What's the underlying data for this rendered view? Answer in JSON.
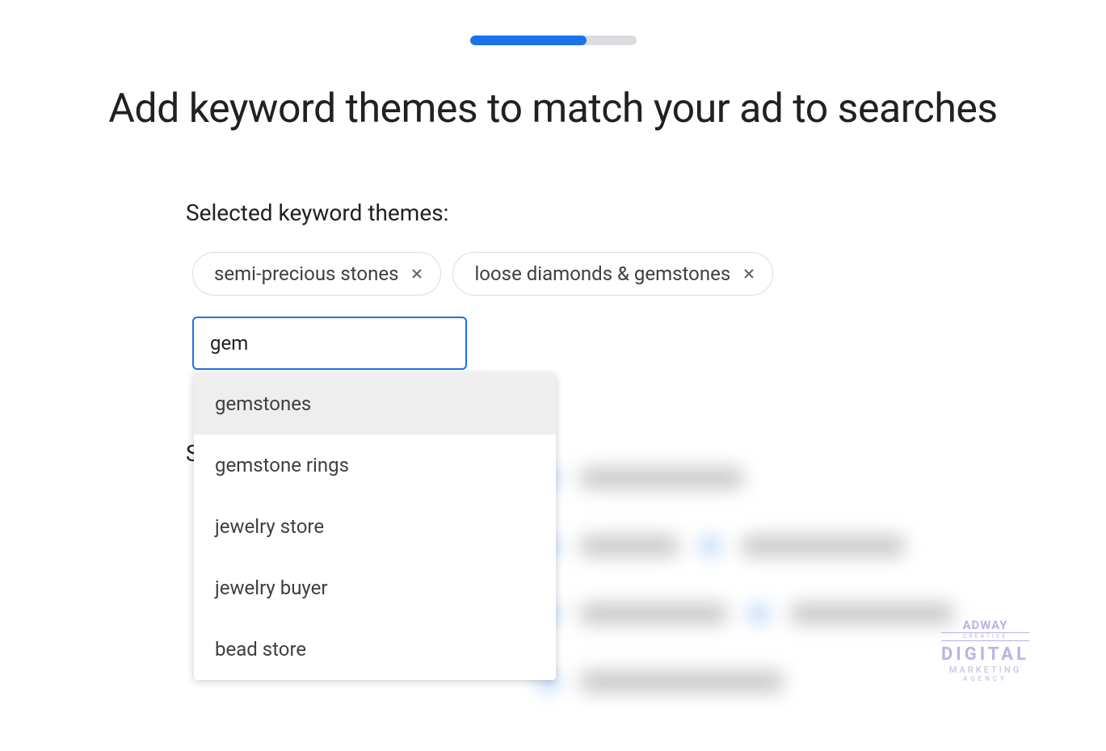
{
  "progress": {
    "percent": 70
  },
  "title": "Add keyword themes to match your ad to searches",
  "selected_label": "Selected keyword themes:",
  "chips": [
    {
      "label": "semi-precious stones"
    },
    {
      "label": "loose diamonds & gemstones"
    }
  ],
  "input": {
    "value": "gem"
  },
  "suggestions": [
    {
      "label": "gemstones",
      "highlighted": true
    },
    {
      "label": "gemstone rings",
      "highlighted": false
    },
    {
      "label": "jewelry store",
      "highlighted": false
    },
    {
      "label": "jewelry buyer",
      "highlighted": false
    },
    {
      "label": "bead store",
      "highlighted": false
    }
  ],
  "watermark": {
    "line1": "ADWAY",
    "sub": "CREATIVE",
    "line2": "DIGITAL",
    "line3": "MARKETING",
    "line4": "AGENCY"
  }
}
